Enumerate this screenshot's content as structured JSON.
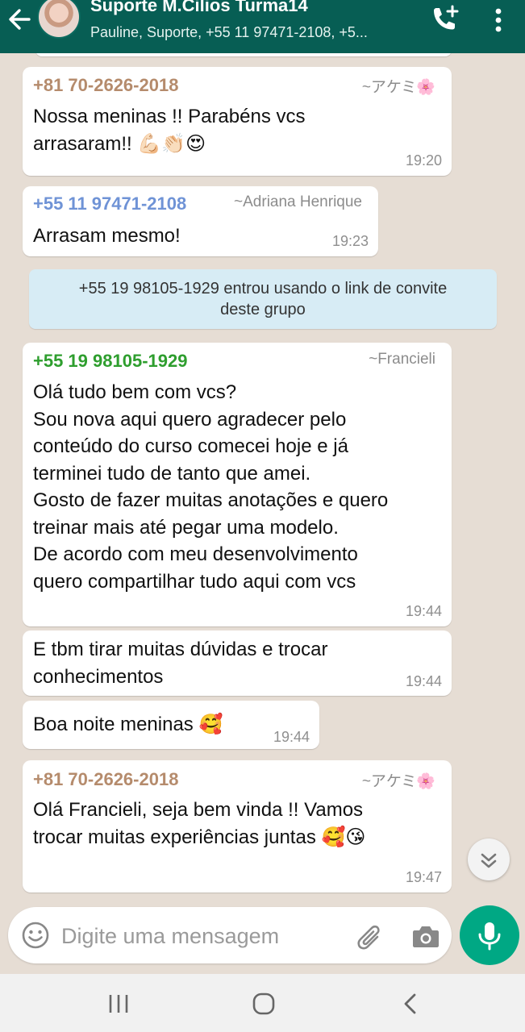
{
  "header": {
    "title": "Suporte M.Cilios Turma14",
    "subtitle": "Pauline, Suporte, +55 11 97471-2108, +5..."
  },
  "messages": [
    {
      "sender": "+81 70-2626-2018",
      "sender_color": "#b58b6c",
      "pushname": "~アケミ🌸",
      "text": "Nossa meninas !! Parabéns vcs\narrasaram!! 💪🏻👏🏻😍",
      "time": "19:20"
    },
    {
      "sender": "+55 11 97471-2108",
      "sender_color": "#6f93d6",
      "pushname": "~Adriana Henrique",
      "text": "Arrasam mesmo!",
      "time": "19:23"
    },
    {
      "sender": "+55 19 98105-1929",
      "sender_color": "#2e9e2e",
      "pushname": "~Francieli",
      "text": "Olá tudo bem com vcs?\nSou nova aqui quero agradecer pelo\nconteúdo do curso comecei hoje e já\nterminei tudo de tanto que amei.\nGosto de fazer muitas anotações e quero\ntreinar mais até pegar uma modelo.\nDe acordo com meu desenvolvimento\nquero compartilhar tudo aqui com vcs",
      "time": "19:44"
    },
    {
      "text": "E tbm tirar muitas dúvidas e trocar\nconhecimentos",
      "time": "19:44"
    },
    {
      "text": "Boa noite meninas 🥰",
      "time": "19:44"
    },
    {
      "sender": "+81 70-2626-2018",
      "sender_color": "#b58b6c",
      "pushname": "~アケミ🌸",
      "text": "Olá Francieli, seja bem vinda !! Vamos\ntrocar muitas experiências juntas 🥰😘",
      "time": "19:47"
    }
  ],
  "system_message": "+55 19 98105-1929 entrou usando o link de convite\ndeste grupo",
  "input": {
    "placeholder": "Digite uma mensagem"
  },
  "colors": {
    "header": "#075e54",
    "accent": "#00a884",
    "chat_bg": "#e6ddd4",
    "system_bg": "#d7ecf5"
  },
  "icons": [
    "back-arrow-icon",
    "avatar",
    "add-call-icon",
    "more-vert-icon",
    "emoji-icon",
    "attach-icon",
    "camera-icon",
    "mic-icon",
    "scroll-down-icon",
    "nav-recent-icon",
    "nav-home-icon",
    "nav-back-icon"
  ]
}
